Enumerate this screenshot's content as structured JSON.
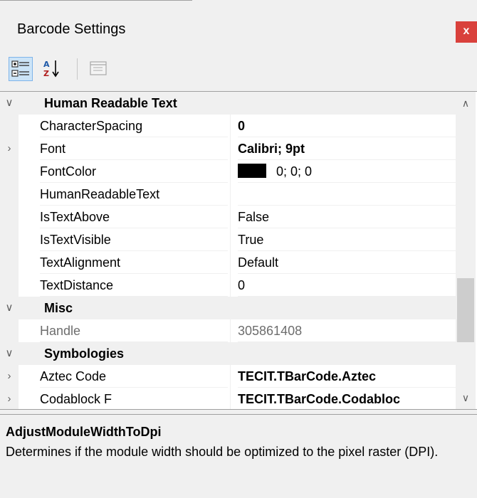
{
  "window": {
    "title": "Barcode Settings",
    "close_label": "x"
  },
  "toolbar": {
    "categorized_icon": "categorized-icon",
    "alphabetical_icon": "alphabetical-sort-icon",
    "property_pages_icon": "property-pages-icon"
  },
  "grid": {
    "rows": [
      {
        "kind": "category",
        "expander": "∨",
        "name": "Human Readable Text"
      },
      {
        "kind": "property",
        "expander": "",
        "name": "CharacterSpacing",
        "value": "0",
        "bold": true
      },
      {
        "kind": "property",
        "expander": "›",
        "name": "Font",
        "value": "Calibri; 9pt",
        "bold": true
      },
      {
        "kind": "property",
        "expander": "",
        "name": "FontColor",
        "value": "0; 0; 0",
        "swatch": "#000000"
      },
      {
        "kind": "property",
        "expander": "",
        "name": "HumanReadableText",
        "value": ""
      },
      {
        "kind": "property",
        "expander": "",
        "name": "IsTextAbove",
        "value": "False"
      },
      {
        "kind": "property",
        "expander": "",
        "name": "IsTextVisible",
        "value": "True"
      },
      {
        "kind": "property",
        "expander": "",
        "name": "TextAlignment",
        "value": "Default"
      },
      {
        "kind": "property",
        "expander": "",
        "name": "TextDistance",
        "value": "0"
      },
      {
        "kind": "category",
        "expander": "∨",
        "name": "Misc"
      },
      {
        "kind": "property",
        "expander": "",
        "name": "Handle",
        "value": "305861408",
        "dim": true
      },
      {
        "kind": "category",
        "expander": "∨",
        "name": "Symbologies"
      },
      {
        "kind": "property",
        "expander": "›",
        "name": "Aztec Code",
        "value": "TECIT.TBarCode.Aztec",
        "bold": true
      },
      {
        "kind": "property",
        "expander": "›",
        "name": "Codablock F",
        "value": "TECIT.TBarCode.Codabloc",
        "bold": true
      }
    ]
  },
  "scrollbar": {
    "up_glyph": "∧",
    "down_glyph": "∨"
  },
  "help": {
    "title": "AdjustModuleWidthToDpi",
    "description": "Determines if the module width should be optimized to the pixel raster (DPI)."
  },
  "colors": {
    "close_button": "#d9413c",
    "selected_tool": "#cce4f7",
    "font_color_swatch": "#000000"
  }
}
